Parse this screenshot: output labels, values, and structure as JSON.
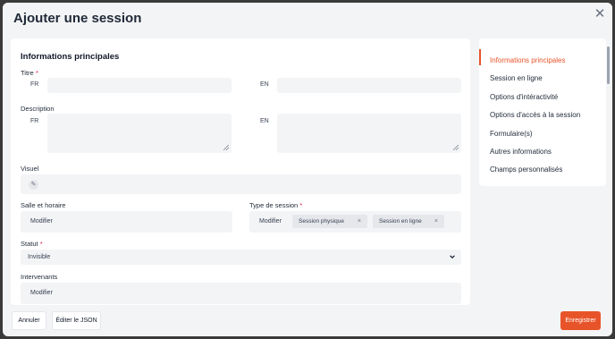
{
  "header": {
    "title": "Ajouter une session",
    "close_symbol": "✕"
  },
  "form": {
    "section_title": "Informations principales",
    "titre": {
      "label": "Titre",
      "required_mark": "*",
      "lang_fr": "FR",
      "lang_en": "EN",
      "value_fr": "",
      "value_en": ""
    },
    "description": {
      "label": "Description",
      "lang_fr": "FR",
      "lang_en": "EN",
      "value_fr": "",
      "value_en": ""
    },
    "visuel": {
      "label": "Visuel"
    },
    "salle": {
      "label": "Salle et horaire",
      "button": "Modifier"
    },
    "type_session": {
      "label": "Type de session",
      "required_mark": "*",
      "button": "Modifier",
      "tags": [
        "Session physique",
        "Session en ligne"
      ],
      "tag_remove": "×"
    },
    "statut": {
      "label": "Statut",
      "required_mark": "*",
      "value": "Invisible"
    },
    "intervenants": {
      "label": "Intervenants",
      "button": "Modifier"
    }
  },
  "sidebar": {
    "items": [
      "Informations principales",
      "Session en ligne",
      "Options d'intéractivité",
      "Options d'accès à la session",
      "Formulaire(s)",
      "Autres informations",
      "Champs personnalisés"
    ],
    "active_index": 0
  },
  "footer": {
    "cancel": "Annuler",
    "edit_json": "Éditer le JSON",
    "save": "Enregistrer"
  },
  "colors": {
    "accent": "#e8542a",
    "required": "#e11d48",
    "background": "#f3f4f6"
  }
}
